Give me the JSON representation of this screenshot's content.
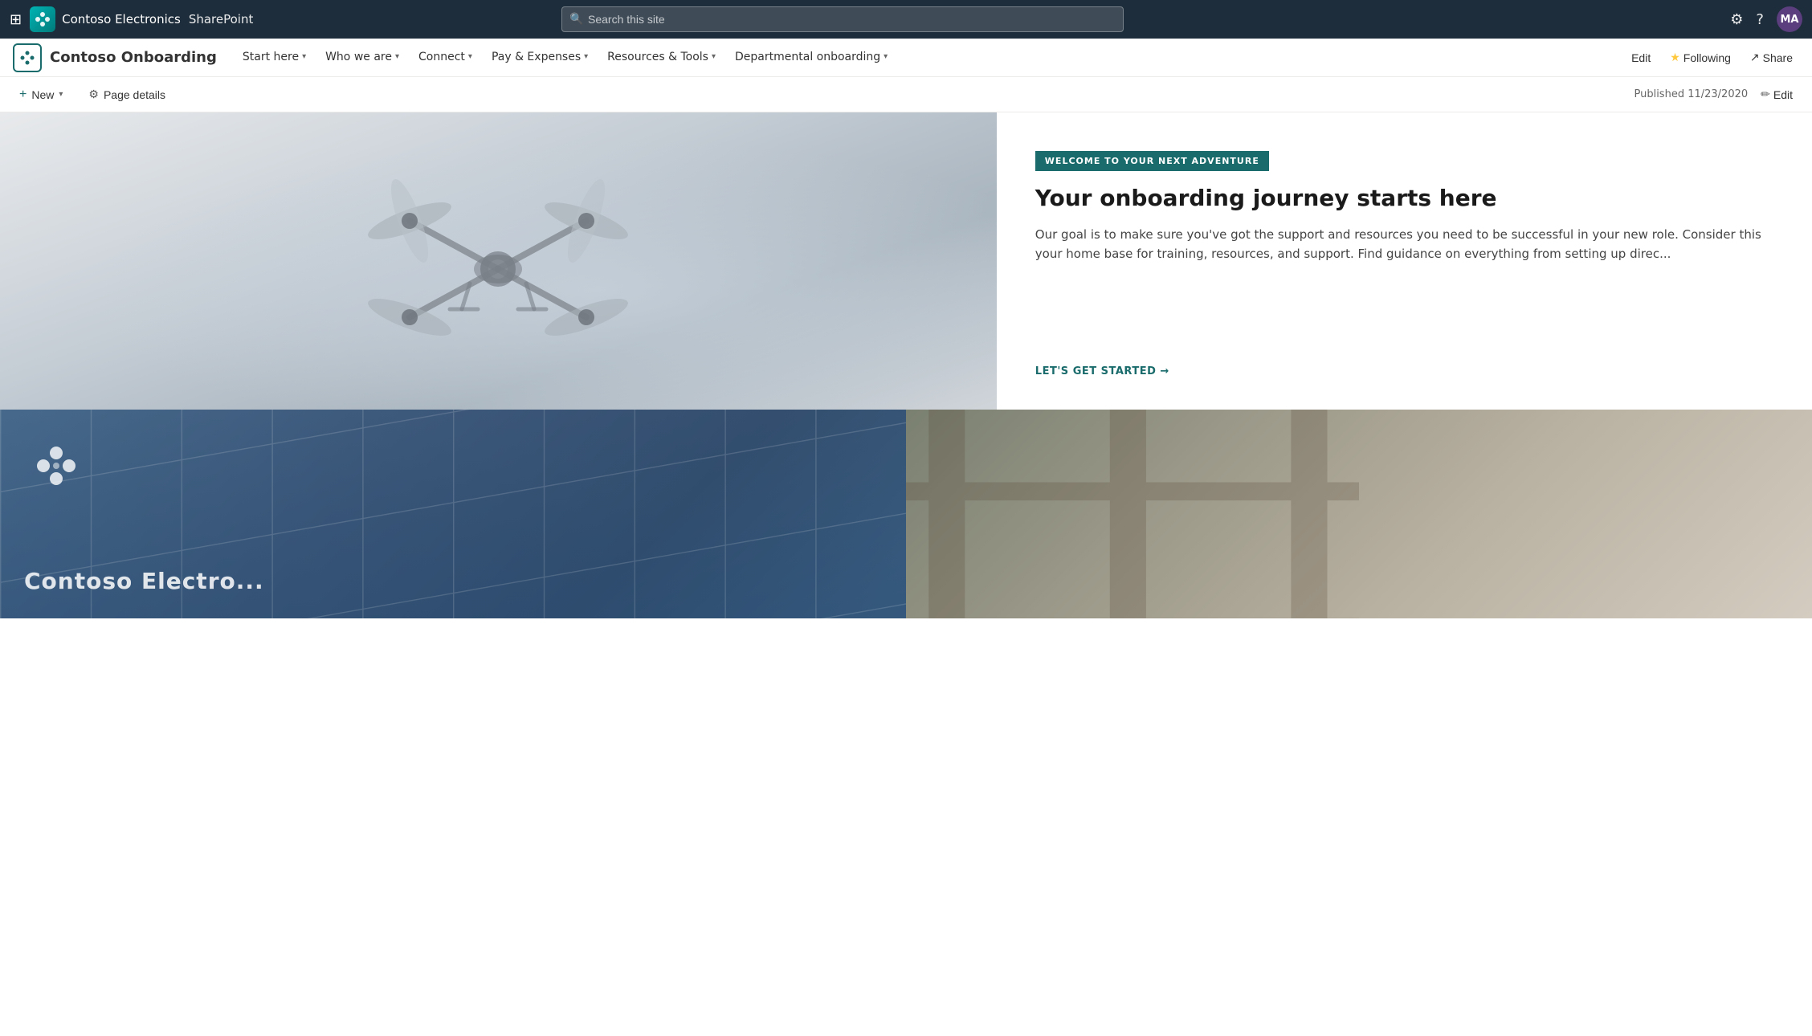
{
  "topBar": {
    "companyName": "Contoso Electronics",
    "appName": "SharePoint",
    "search": {
      "placeholder": "Search this site"
    },
    "avatar": "MA",
    "avatarColor": "#5a3e7d"
  },
  "siteNav": {
    "siteTitle": "Contoso Onboarding",
    "navItems": [
      {
        "label": "Start here",
        "hasDropdown": true
      },
      {
        "label": "Who we are",
        "hasDropdown": true
      },
      {
        "label": "Connect",
        "hasDropdown": true
      },
      {
        "label": "Pay & Expenses",
        "hasDropdown": true
      },
      {
        "label": "Resources & Tools",
        "hasDropdown": true
      },
      {
        "label": "Departmental onboarding",
        "hasDropdown": true
      }
    ],
    "actions": {
      "edit": "Edit",
      "following": "Following",
      "share": "Share"
    }
  },
  "toolbar": {
    "newLabel": "New",
    "pageDetailsLabel": "Page details",
    "publishedText": "Published 11/23/2020",
    "editLabel": "Edit"
  },
  "hero": {
    "badge": "WELCOME TO YOUR NEXT ADVENTURE",
    "title": "Your onboarding journey starts here",
    "description": "Our goal is to make sure you've got the support and resources you need to be successful in your new role. Consider this your home base for training, resources, and support. Find guidance on everything from setting up direc...",
    "cta": "LET'S GET STARTED →"
  },
  "bottomLeft": {
    "buildingText": "Contoso Electro..."
  },
  "colors": {
    "teal": "#1a6b6b",
    "badgeBg": "#1a7a7a",
    "navBg": "#1e2d3b",
    "accentTeal": "#00b4b4"
  }
}
